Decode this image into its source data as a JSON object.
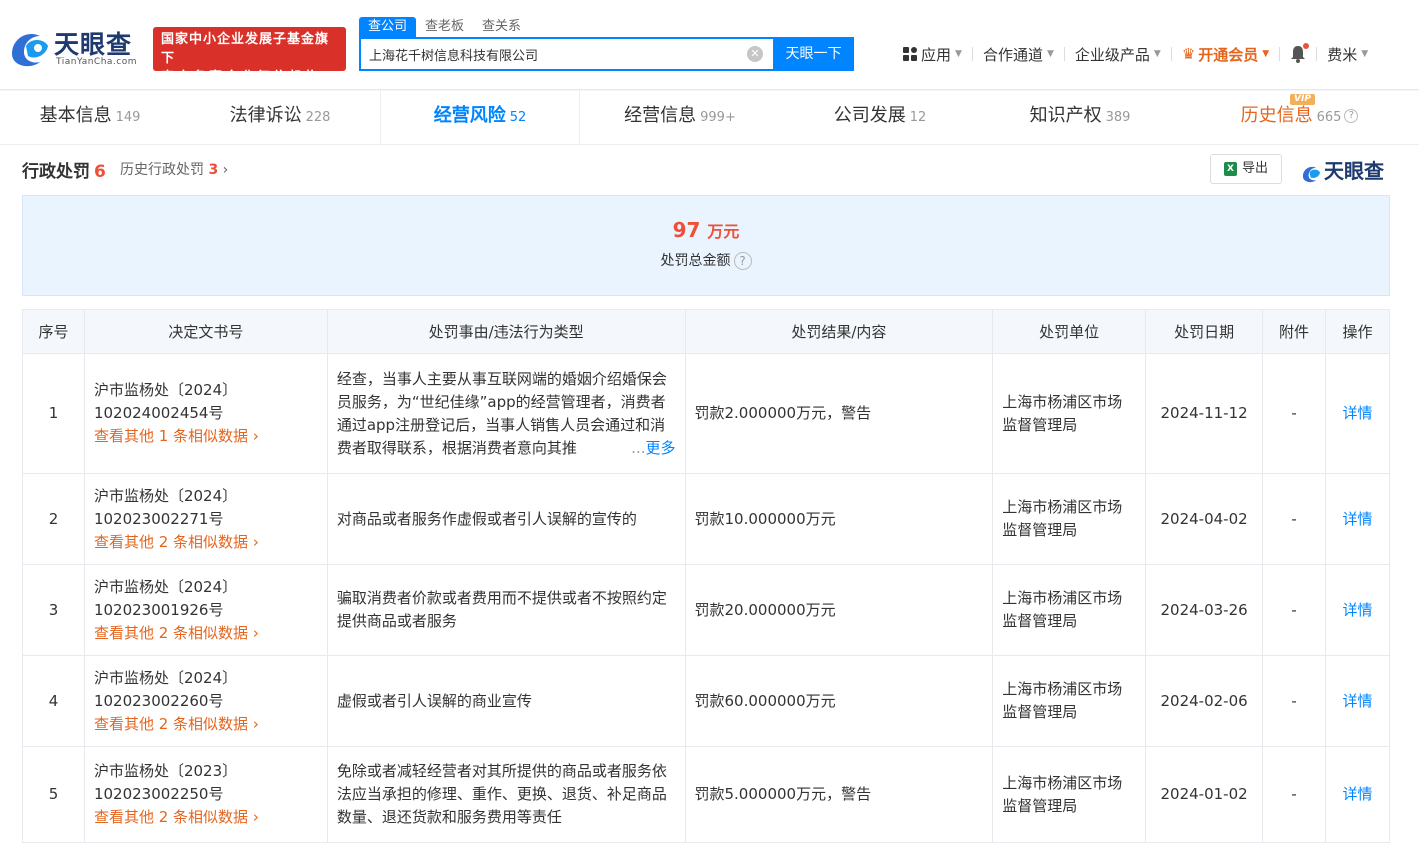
{
  "header": {
    "logo_text": "天眼查",
    "logo_sub": "TianYanCha.com",
    "badge_line1": "国家中小企业发展子基金旗下",
    "badge_line2": "官方备案企业征信机构",
    "search_tabs": [
      "查公司",
      "查老板",
      "查关系"
    ],
    "search_value": "上海花千树信息科技有限公司",
    "search_button": "天眼一下",
    "nav": {
      "app": "应用",
      "cooperation": "合作通道",
      "enterprise": "企业级产品",
      "vip": "开通会员",
      "user": "费米"
    }
  },
  "tabs": [
    {
      "label": "基本信息",
      "count": "149"
    },
    {
      "label": "法律诉讼",
      "count": "228"
    },
    {
      "label": "经营风险",
      "count": "52"
    },
    {
      "label": "经营信息",
      "count": "999+"
    },
    {
      "label": "公司发展",
      "count": "12"
    },
    {
      "label": "知识产权",
      "count": "389"
    },
    {
      "label": "历史信息",
      "count": "665",
      "badge": "VIP"
    }
  ],
  "section": {
    "title": "行政处罚",
    "count": "6",
    "history_label": "历史行政处罚",
    "history_count": "3",
    "export_label": "导出",
    "brand": "天眼查"
  },
  "summary": {
    "amount": "97",
    "unit": "万元",
    "label": "处罚总金额"
  },
  "table": {
    "headers": [
      "序号",
      "决定文书号",
      "处罚事由/违法行为类型",
      "处罚结果/内容",
      "处罚单位",
      "处罚日期",
      "附件",
      "操作"
    ],
    "rows": [
      {
        "no": "1",
        "doc": "沪市监杨处〔2024〕102024002454号",
        "similar": "查看其他 1 条相似数据",
        "reason": "经查，当事人主要从事互联网端的婚姻介绍婚保会员服务，为“世纪佳缘”app的经营管理者，消费者通过app注册登记后，当事人销售人员会通过和消费者取得联系，根据消费者意向其推",
        "reason_more": "更多",
        "result": "罚款2.000000万元，警告",
        "unit": "上海市杨浦区市场监督管理局",
        "date": "2024-11-12",
        "attachment": "-",
        "action": "详情"
      },
      {
        "no": "2",
        "doc": "沪市监杨处〔2024〕102023002271号",
        "similar": "查看其他 2 条相似数据",
        "reason": "对商品或者服务作虚假或者引人误解的宣传的",
        "reason_more": "",
        "result": "罚款10.000000万元",
        "unit": "上海市杨浦区市场监督管理局",
        "date": "2024-04-02",
        "attachment": "-",
        "action": "详情"
      },
      {
        "no": "3",
        "doc": "沪市监杨处〔2024〕102023001926号",
        "similar": "查看其他 2 条相似数据",
        "reason": "骗取消费者价款或者费用而不提供或者不按照约定提供商品或者服务",
        "reason_more": "",
        "result": "罚款20.000000万元",
        "unit": "上海市杨浦区市场监督管理局",
        "date": "2024-03-26",
        "attachment": "-",
        "action": "详情"
      },
      {
        "no": "4",
        "doc": "沪市监杨处〔2024〕102023002260号",
        "similar": "查看其他 2 条相似数据",
        "reason": "虚假或者引人误解的商业宣传",
        "reason_more": "",
        "result": "罚款60.000000万元",
        "unit": "上海市杨浦区市场监督管理局",
        "date": "2024-02-06",
        "attachment": "-",
        "action": "详情"
      },
      {
        "no": "5",
        "doc": "沪市监杨处〔2023〕102023002250号",
        "similar": "查看其他 2 条相似数据",
        "reason": "免除或者减轻经营者对其所提供的商品或者服务依法应当承担的修理、重作、更换、退货、补足商品数量、退还货款和服务费用等责任",
        "reason_more": "",
        "result": "罚款5.000000万元，警告",
        "unit": "上海市杨浦区市场监督管理局",
        "date": "2024-01-02",
        "attachment": "-",
        "action": "详情"
      }
    ]
  }
}
